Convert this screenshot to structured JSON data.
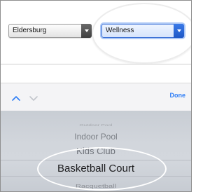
{
  "form": {
    "location_select": {
      "value": "Eldersburg"
    },
    "category_select": {
      "value": "Wellness"
    }
  },
  "toolbar": {
    "prev_icon": "chevron-up-icon",
    "next_icon": "chevron-down-icon",
    "done_label": "Done",
    "accent_color": "#2d7df6"
  },
  "picker": {
    "items": [
      "Outdoor Pool",
      "Indoor Pool",
      "Kids Club",
      "Basketball Court",
      "Racquetball"
    ],
    "selected": "Basketball Court"
  }
}
